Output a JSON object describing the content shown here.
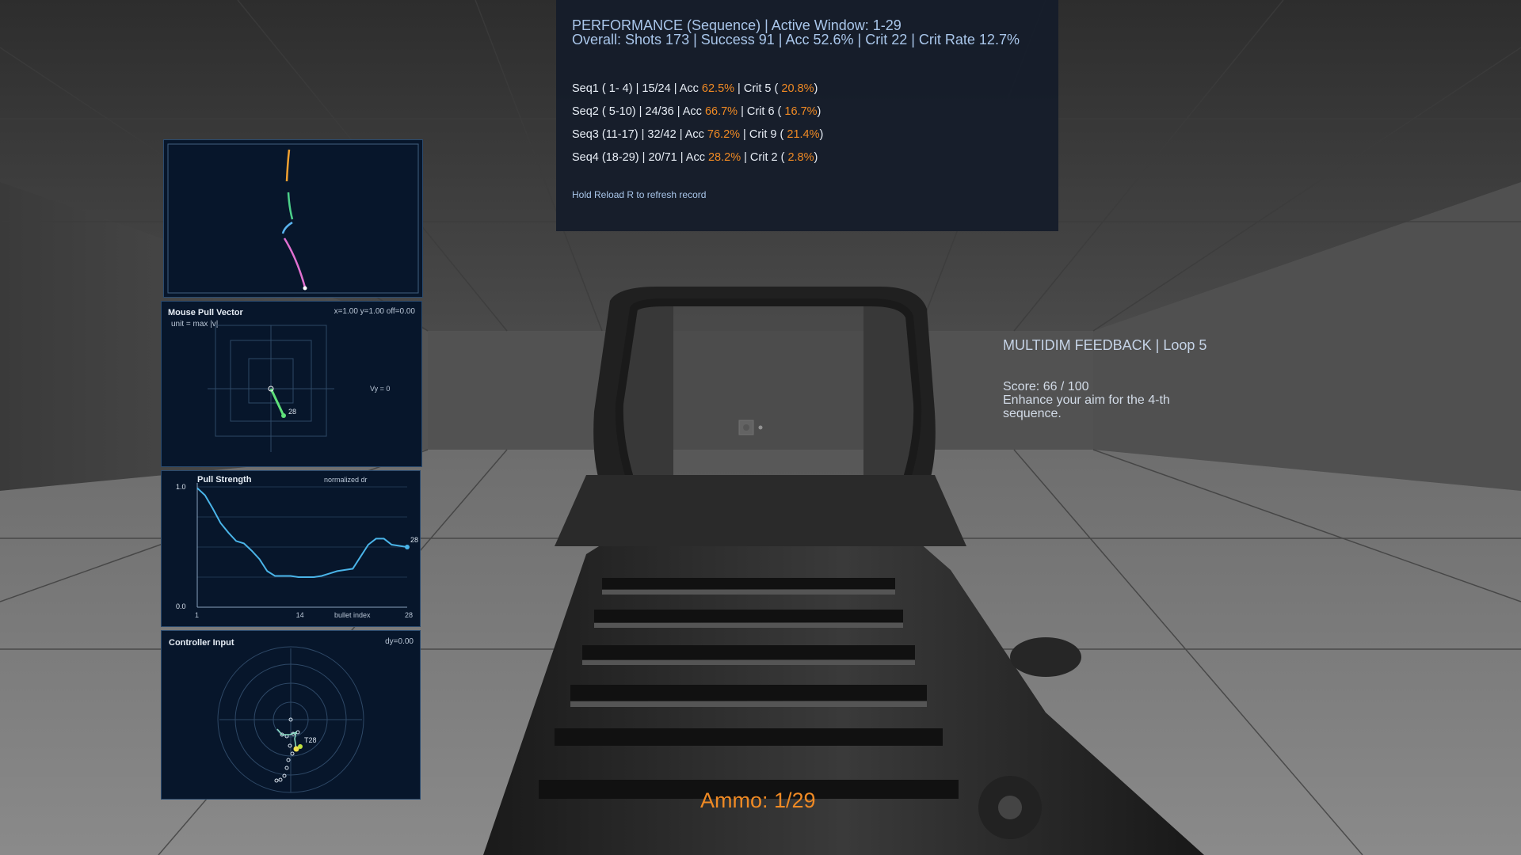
{
  "performance": {
    "header_line1": "PERFORMANCE (Sequence) | Active Window: 1-29",
    "header_line2": "Overall: Shots 173 | Success 91 | Acc 52.6% | Crit 22 | Crit Rate 12.7%",
    "sequences": [
      {
        "label": "Seq1 ( 1- 4) | 15/24 | Acc ",
        "acc": "62.5%",
        "mid": " | Crit 5 ( ",
        "crit_rate": "20.8%",
        "end": ")"
      },
      {
        "label": "Seq2 ( 5-10) | 24/36 | Acc ",
        "acc": "66.7%",
        "mid": " | Crit 6 ( ",
        "crit_rate": "16.7%",
        "end": ")"
      },
      {
        "label": "Seq3 (11-17) | 32/42 | Acc ",
        "acc": "76.2%",
        "mid": " | Crit 9 ( ",
        "crit_rate": "21.4%",
        "end": ")"
      },
      {
        "label": "Seq4 (18-29) | 20/71 | Acc ",
        "acc": "28.2%",
        "mid": " | Crit 2 (  ",
        "crit_rate": "2.8%",
        "end": ")"
      }
    ],
    "hint": "Hold Reload R to refresh record"
  },
  "feedback": {
    "title": "MULTIDIM FEEDBACK | Loop 5",
    "score": "Score: 66 / 100",
    "message": "Enhance your aim for the 4-th sequence."
  },
  "ammo": "Ammo: 1/29",
  "mouse_pull": {
    "title": "Mouse Pull Vector",
    "readout": "x=1.00 y=1.00 off=0.00",
    "unit": "unit = max |v|",
    "vy_label": "Vy = 0",
    "bullet_label": "28"
  },
  "pull_strength": {
    "title": "Pull Strength",
    "subtitle": "normalized dr",
    "y_top": "1.0",
    "y_bottom": "0.0",
    "x_ticks": [
      "1",
      "14",
      "28"
    ],
    "x_label": "bullet index",
    "end_label": "28"
  },
  "controller": {
    "title": "Controller Input",
    "readout": "dy=0.00",
    "end_label": "T28"
  },
  "colors": {
    "accent_orange": "#f08a24",
    "panel_bg": "#07162b",
    "panel_border": "#2a4a6e",
    "pull_line": "#4ab4e8",
    "vector_green": "#5fe07a",
    "trail_orange": "#f0a030",
    "trail_green": "#4cd08a",
    "trail_blue": "#5ab4f0",
    "trail_pink": "#e070d0"
  },
  "chart_data": {
    "type": "line",
    "title": "Pull Strength",
    "xlabel": "bullet index",
    "ylabel": "normalized dr",
    "xlim": [
      1,
      28
    ],
    "ylim": [
      0,
      1
    ],
    "x": [
      1,
      2,
      3,
      4,
      5,
      6,
      7,
      8,
      9,
      10,
      11,
      12,
      13,
      14,
      15,
      16,
      17,
      18,
      19,
      20,
      21,
      22,
      23,
      24,
      25,
      26,
      27,
      28
    ],
    "values": [
      0.99,
      0.93,
      0.82,
      0.7,
      0.62,
      0.55,
      0.53,
      0.47,
      0.4,
      0.3,
      0.26,
      0.26,
      0.26,
      0.25,
      0.25,
      0.25,
      0.26,
      0.28,
      0.3,
      0.31,
      0.32,
      0.42,
      0.52,
      0.57,
      0.57,
      0.52,
      0.51,
      0.5
    ]
  }
}
